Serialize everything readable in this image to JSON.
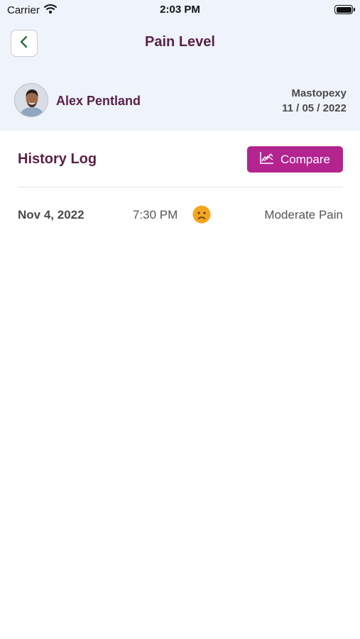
{
  "status_bar": {
    "carrier": "Carrier",
    "time": "2:03 PM",
    "icons": [
      "wifi-icon",
      "battery-icon"
    ]
  },
  "header": {
    "back_icon": "chevron-left-icon",
    "title": "Pain Level"
  },
  "patient": {
    "name": "Alex Pentland",
    "procedure": "Mastopexy",
    "date": "11 / 05 / 2022"
  },
  "history": {
    "title": "History Log",
    "compare_label": "Compare",
    "compare_icon": "chart-icon",
    "entries": [
      {
        "date": "Nov 4, 2022",
        "time": "7:30 PM",
        "mood_icon": "frown-face-icon",
        "level": "Moderate Pain"
      }
    ]
  },
  "colors": {
    "header_bg": "#eef3fc",
    "brand_purple": "#5b2047",
    "accent_magenta": "#b3248f",
    "back_chevron": "#2e6b3e",
    "emoji": "#f3a421"
  }
}
